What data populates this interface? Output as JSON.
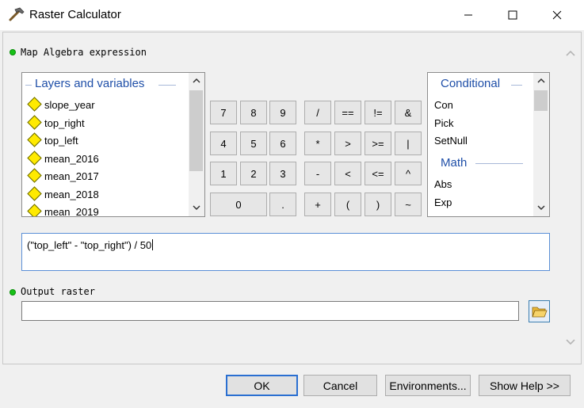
{
  "window": {
    "title": "Raster Calculator"
  },
  "expression_section": {
    "label": "Map Algebra expression"
  },
  "layers": {
    "header": "Layers and variables",
    "items": [
      "slope_year",
      "top_right",
      "top_left",
      "mean_2016",
      "mean_2017",
      "mean_2018",
      "mean_2019"
    ]
  },
  "functions": {
    "conditional_header": "Conditional",
    "conditional_items": [
      "Con",
      "Pick",
      "SetNull"
    ],
    "math_header": "Math",
    "math_items": [
      "Abs",
      "Exp"
    ]
  },
  "keypad": {
    "k7": "7",
    "k8": "8",
    "k9": "9",
    "div": "/",
    "eq": "==",
    "neq": "!=",
    "and": "&",
    "k4": "4",
    "k5": "5",
    "k6": "6",
    "mul": "*",
    "gt": ">",
    "gte": ">=",
    "or": "|",
    "k1": "1",
    "k2": "2",
    "k3": "3",
    "sub": "-",
    "lt": "<",
    "lte": "<=",
    "xor": "^",
    "k0": "0",
    "dot": ".",
    "add": "+",
    "lparen": "(",
    "rparen": ")",
    "not": "~"
  },
  "expression": {
    "value": "(\"top_left\" - \"top_right\") / 50"
  },
  "output_section": {
    "label": "Output raster",
    "value": ""
  },
  "buttons": {
    "ok": "OK",
    "cancel": "Cancel",
    "environments": "Environments...",
    "show_help": "Show Help >>"
  },
  "colors": {
    "accent": "#1f4fa8",
    "dot": "#17c117",
    "ok_border": "#2a6fd1"
  },
  "icons": [
    "hammer-icon",
    "minimize-icon",
    "maximize-icon",
    "close-icon",
    "folder-open-icon",
    "chevron-up-icon",
    "chevron-down-icon",
    "green-dot-icon",
    "yellow-diamond-icon"
  ]
}
